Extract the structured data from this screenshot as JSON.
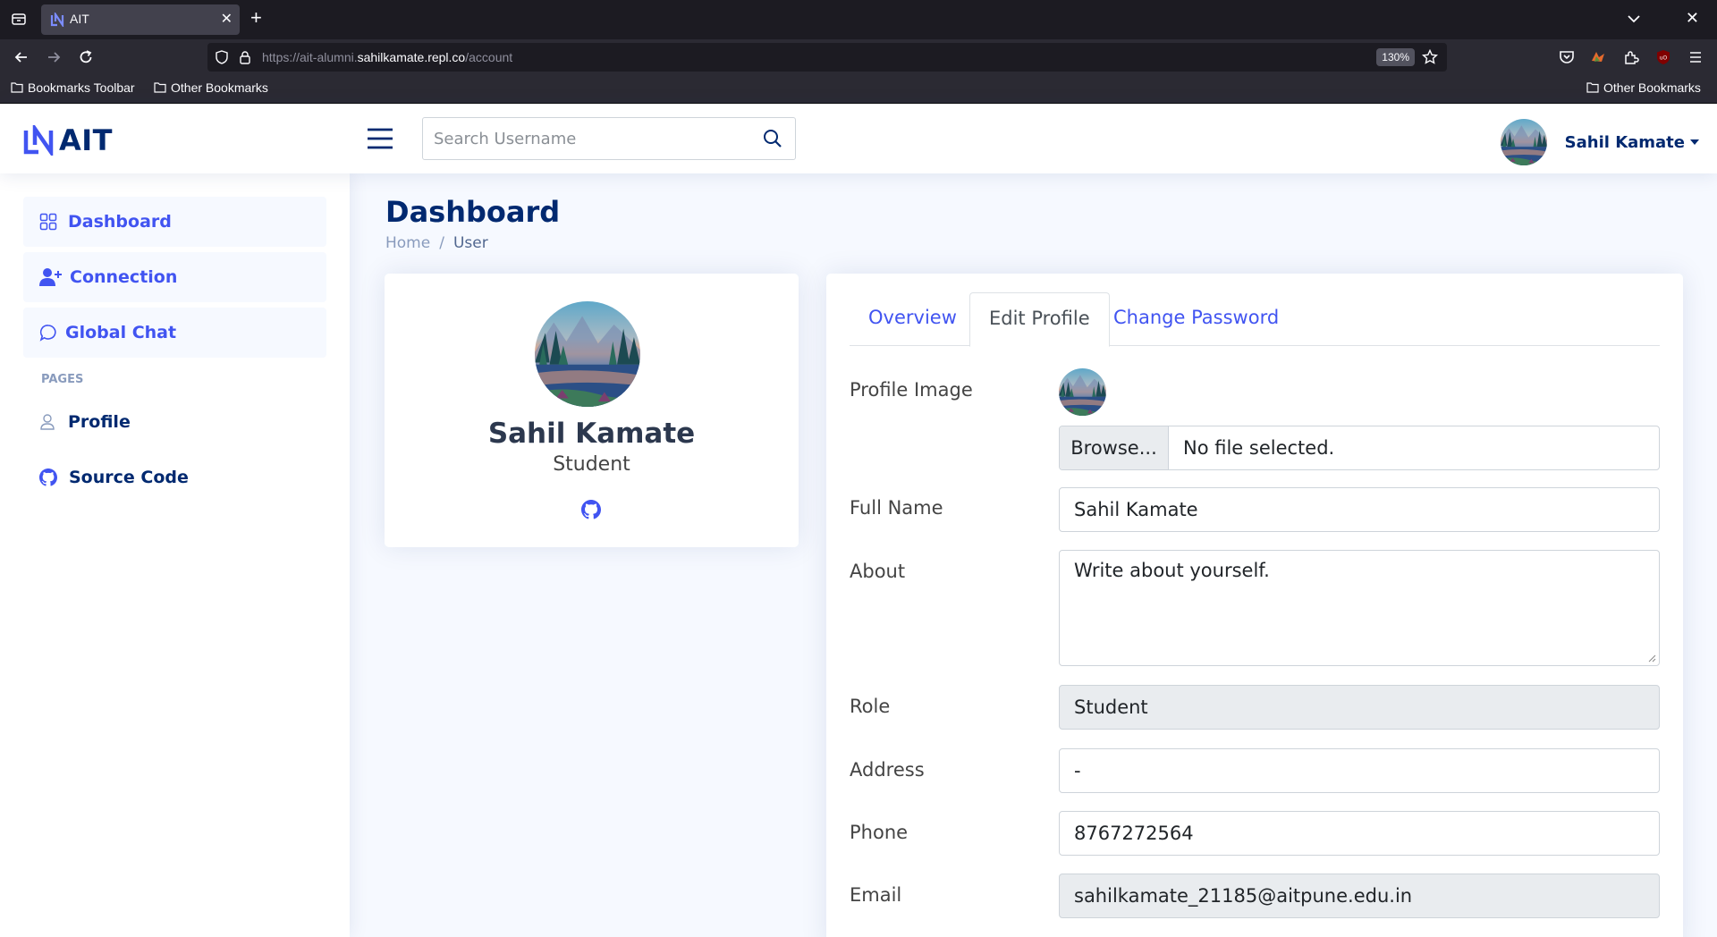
{
  "browser": {
    "tab_title": "AIT",
    "url_prefix": "https://ait-alumni.",
    "url_host": "sahilkamate.repl.co",
    "url_path": "/account",
    "zoom": "130%",
    "bookmarks_toolbar": "Bookmarks Toolbar",
    "other_bookmarks_left": "Other Bookmarks",
    "other_bookmarks_right": "Other Bookmarks"
  },
  "header": {
    "logo_text": "AIT",
    "search_placeholder": "Search Username",
    "user_name": "Sahil Kamate"
  },
  "sidebar": {
    "items": [
      {
        "label": "Dashboard",
        "icon": "grid-icon"
      },
      {
        "label": "Connection",
        "icon": "person-plus-icon"
      },
      {
        "label": "Global Chat",
        "icon": "chat-icon"
      }
    ],
    "heading": "PAGES",
    "pages": [
      {
        "label": "Profile",
        "icon": "person-icon"
      },
      {
        "label": "Source Code",
        "icon": "github-icon"
      }
    ]
  },
  "main": {
    "title": "Dashboard",
    "breadcrumb": {
      "home": "Home",
      "separator": "/",
      "current": "User"
    },
    "profile_card": {
      "name": "Sahil Kamate",
      "role": "Student"
    },
    "tabs": [
      "Overview",
      "Edit Profile",
      "Change Password"
    ],
    "active_tab": "Edit Profile",
    "form": {
      "profile_image_label": "Profile Image",
      "browse_label": "Browse...",
      "file_status": "No file selected.",
      "full_name_label": "Full Name",
      "full_name": "Sahil Kamate",
      "about_label": "About",
      "about": "Write about yourself.",
      "role_label": "Role",
      "role": "Student",
      "address_label": "Address",
      "address": "-",
      "phone_label": "Phone",
      "phone": "8767272564",
      "email_label": "Email",
      "email": "sahilkamate_21185@aitpune.edu.in"
    }
  },
  "colors": {
    "primary": "#4154f1",
    "navy": "#012970",
    "background": "#f6f9ff"
  }
}
